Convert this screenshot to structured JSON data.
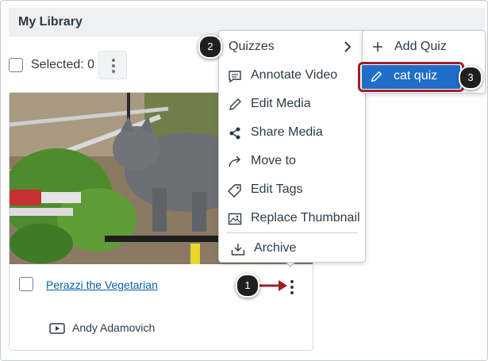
{
  "library": {
    "title": "My Library",
    "selected_label": "Selected: 0"
  },
  "media_card": {
    "title": "Perazzi the Vegetarian",
    "owner": "Andy Adamovich"
  },
  "context_menu": {
    "items": [
      {
        "label": "Quizzes",
        "icon": "chevron-right-icon"
      },
      {
        "label": "Annotate Video",
        "icon": "annotate-icon"
      },
      {
        "label": "Edit Media",
        "icon": "pencil-icon"
      },
      {
        "label": "Share Media",
        "icon": "share-icon"
      },
      {
        "label": "Move to",
        "icon": "move-arrow-icon"
      },
      {
        "label": "Edit Tags",
        "icon": "tag-icon"
      },
      {
        "label": "Replace Thumbnail",
        "icon": "image-icon"
      },
      {
        "label": "Archive",
        "icon": "archive-icon"
      }
    ]
  },
  "quiz_submenu": {
    "add_label": "Add Quiz",
    "quiz_label": "cat quiz"
  },
  "callouts": [
    "1",
    "2",
    "3"
  ],
  "colors": {
    "accent": "#1f6ec7",
    "highlight_outline": "#a01c27",
    "link": "#0b5ea8",
    "callout_bg": "#1f1f1f"
  }
}
